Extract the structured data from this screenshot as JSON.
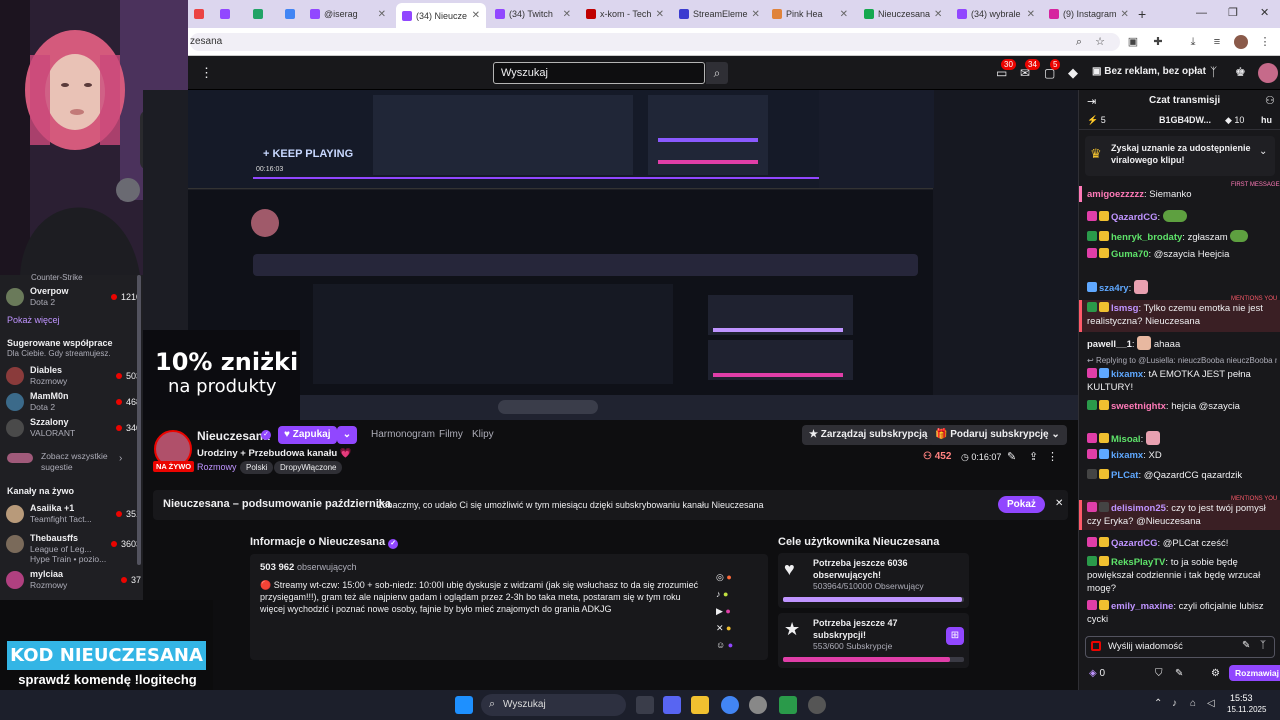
{
  "browser": {
    "tabs": [
      {
        "label": "",
        "color": "#eb4343"
      },
      {
        "label": "",
        "color": "#9147ff"
      },
      {
        "label": "",
        "color": "#21a366"
      },
      {
        "label": "",
        "color": "#4285f4"
      },
      {
        "label": "@iserag",
        "color": "#9147ff"
      },
      {
        "label": "(34) Nieucze",
        "color": "#9147ff"
      },
      {
        "label": "(34) Twitch",
        "color": "#9147ff"
      },
      {
        "label": "x-kom - Tech",
        "color": "#c00000"
      },
      {
        "label": "StreamEleme",
        "color": "#3b3bd0"
      },
      {
        "label": "Pink Hea",
        "color": "#e0833b"
      },
      {
        "label": "Nieuczesana",
        "color": "#15a84f"
      },
      {
        "label": "(34) wybrale",
        "color": "#9147ff"
      },
      {
        "label": "(9) Instagram",
        "color": "#d6249f"
      }
    ],
    "address": "zesana"
  },
  "topnav": {
    "search_placeholder": "Wyszukaj",
    "badges": [
      "30",
      "34",
      "5"
    ],
    "ad_free": "Bez reklam, bez opłat"
  },
  "sidebar": {
    "top_partial": "Counter-Strike",
    "channels_top": [
      {
        "name": "Overpow",
        "game": "Dota 2",
        "viewers": "1210",
        "color": "#6a7a5a"
      }
    ],
    "show_more": "Pokaż więcej",
    "suggested_title": "Sugerowane współprace",
    "suggested_sub": "Dla Ciebie. Gdy streamujesz.",
    "suggested": [
      {
        "name": "Diables",
        "game": "Rozmowy",
        "viewers": "503",
        "color": "#8a3b3b"
      },
      {
        "name": "MamM0n",
        "game": "Dota 2",
        "viewers": "468",
        "color": "#3b6a8a"
      },
      {
        "name": "Szzalony",
        "game": "VALORANT",
        "viewers": "340",
        "color": "#4a4a4a"
      }
    ],
    "see_all": "Zobacz wszystkie sugestie",
    "live_title": "Kanały na żywo",
    "live": [
      {
        "name": "Asaiika +1",
        "game": "Teamfight Tact...",
        "viewers": "351",
        "color": "#b89a7a"
      },
      {
        "name": "Thebausffs",
        "game": "League of Leg...",
        "extra": "Hype Train • pozio...",
        "viewers": "3603",
        "color": "#7a6a5a"
      },
      {
        "name": "mylciaa",
        "game": "Rozmowy",
        "viewers": "37",
        "color": "#b04080"
      }
    ]
  },
  "promo": {
    "code": "KOD NIEUCZESANA",
    "sub": "sprawdź komendę !logitechg",
    "discount_line1": "10% zniżki",
    "discount_line2": "na produkty"
  },
  "video": {
    "keep_playing": "KEEP PLAYING",
    "time": "00:16:03"
  },
  "channel": {
    "name": "Nieuczesana",
    "follow": "Zapukaj",
    "nav": [
      "Harmonogram",
      "Filmy",
      "Klipy"
    ],
    "manage_sub": "Zarządzaj subskrypcją",
    "gift_sub": "Podaruj subskrypcję",
    "live_badge": "NA ŻYWO",
    "title": "Urodziny + Przebudowa kanału 💗",
    "category": "Rozmowy",
    "tags": [
      "Polski",
      "DropyWłączone"
    ],
    "viewers": "452",
    "uptime": "0:16:07"
  },
  "recap": {
    "title": "Nieuczesana – podsumowanie października",
    "text": "Zobaczmy, co udało Ci się umożliwić w tym miesiącu dzięki subskrybowaniu kanału Nieuczesana",
    "button": "Pokaż"
  },
  "about": {
    "title": "Informacje o Nieuczesana",
    "followers": "503 962",
    "followers_label": "obserwujących",
    "description": "🔴 Streamy wt-czw: 15:00 + sob-niedz: 10:00I ubię dyskusje z widzami (jak się wsłuchasz to da się zrozumieć przysięgam!!!), gram też ale najpierw gadam i oglądam przez 2-3h bo taka meta, postaram się w tym roku więcej wychodzić i poznać nowe osoby, fajnie by było mieć znajomych do grania ADKJG"
  },
  "goals": {
    "title": "Cele użytkownika Nieuczesana",
    "items": [
      {
        "title": "Potrzeba jeszcze 6036 obserwujących!",
        "progress_text": "503964/510000 Obserwujący",
        "fraction": 0.988,
        "color": "#bf94ff"
      },
      {
        "title": "Potrzeba jeszcze 47 subskrypcji!",
        "progress_text": "553/600 Subskrypcje",
        "fraction": 0.92,
        "color": "#e03ea8"
      }
    ]
  },
  "chat": {
    "title": "Czat transmisji",
    "counters": [
      "5",
      "B1GB4DW...",
      "10",
      "hu"
    ],
    "viral_banner": "Zyskaj uznanie za udostępnienie viralowego klipu!",
    "first_message": "FIRST MESSAGE",
    "mentions": "MENTIONS YOU",
    "messages": [
      {
        "user": "amigoezzzzz",
        "color": "#ff7ab8",
        "text": "Siemanko"
      },
      {
        "user": "QazardCG",
        "color": "#bf94ff",
        "text": ""
      },
      {
        "user": "henryk_brodaty",
        "color": "#5ee36a",
        "text": "zgłaszam"
      },
      {
        "user": "Guma70",
        "color": "#5ee36a",
        "text": "@szaycia Heejcia"
      },
      {
        "user": "sza4ry",
        "color": "#5fa8ff",
        "text": ""
      },
      {
        "user": "lsmsg",
        "color": "#bf94ff",
        "text": "Tylko czemu emotka nie jest realistyczna?  Nieuczesana"
      },
      {
        "user": "pawell__1",
        "color": "#efeff1",
        "text": "ahaaa"
      },
      {
        "user": "kixamx",
        "color": "#5fa8ff",
        "text": "tA EMOTKA JEST pełna KULTURY!"
      },
      {
        "user": "sweetnightx",
        "color": "#ff7ab8",
        "text": "hejcia @szaycia"
      },
      {
        "user": "Misoal",
        "color": "#5ee36a",
        "text": ""
      },
      {
        "user": "kixamx",
        "color": "#5fa8ff",
        "text": "XD"
      },
      {
        "user": "PLCat",
        "color": "#5fa8ff",
        "text": "@QazardCG qazardzik"
      },
      {
        "user": "delisimon25",
        "color": "#bf94ff",
        "text": "czy to jest twój pomysł czy Eryka? @Nieuczesana"
      },
      {
        "user": "QazardCG",
        "color": "#bf94ff",
        "text": "@PLCat cześć!"
      },
      {
        "user": "ReksPlayTV",
        "color": "#5ee36a",
        "text": "to ja sobie będę powiększał codziennie i tak będę wrzucał mogę?"
      },
      {
        "user": "emily_maxine",
        "color": "#bf94ff",
        "text": "czyli oficjalnie lubisz cycki"
      }
    ],
    "replying": "Replying to @Lusiella: nieuczBooba nieuczBooba n",
    "input_placeholder": "Wyślij wiadomość",
    "points": "0",
    "send": "Rozmawiaj"
  },
  "taskbar": {
    "search": "Wyszukaj",
    "time": "15:53",
    "date": "15.11.2025"
  }
}
